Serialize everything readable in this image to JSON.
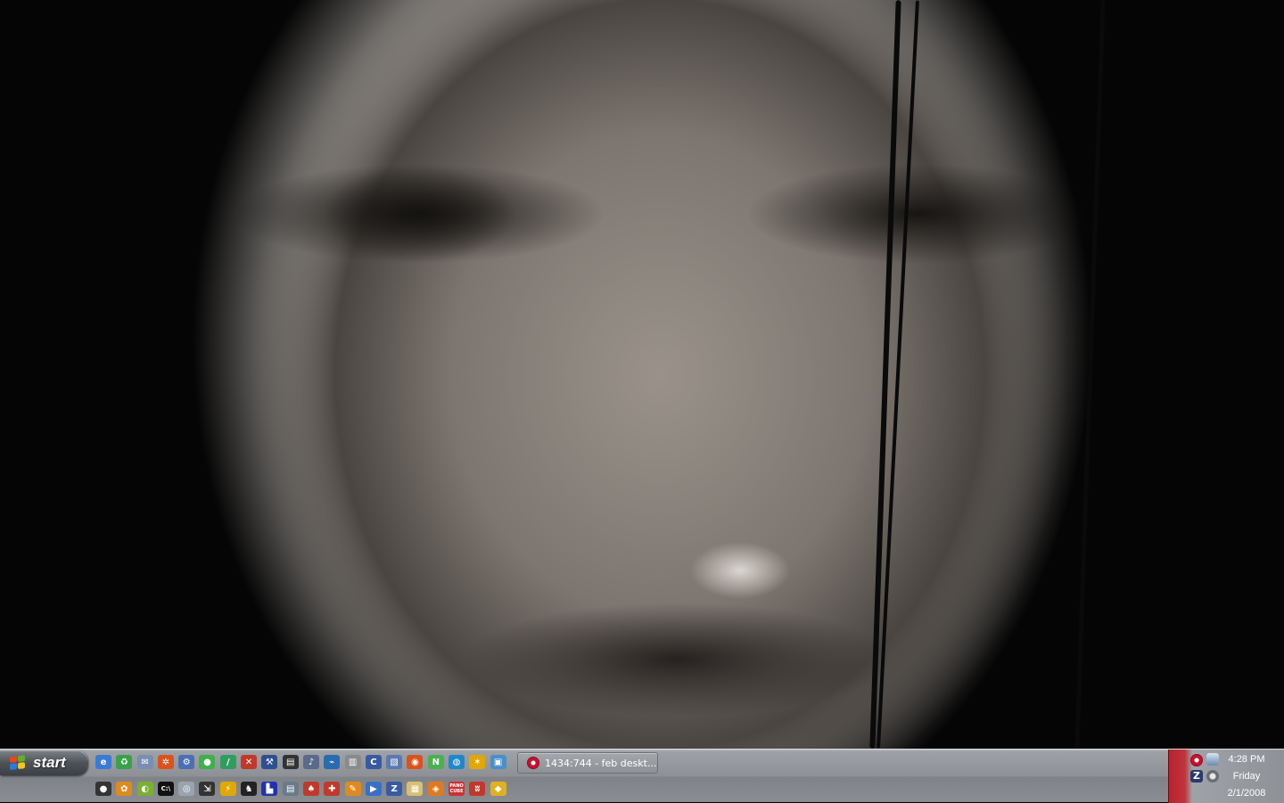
{
  "desktop": {
    "wallpaper": "dark portrait face close-up",
    "colors": {
      "skin": "#9a928a",
      "shadow": "#050505"
    }
  },
  "taskbar": {
    "start_label": "start",
    "quicklaunch_row1": [
      {
        "icon": "ie-icon",
        "glyph": "e",
        "color": "#3a7bd5"
      },
      {
        "icon": "recycle-icon",
        "glyph": "♻",
        "color": "#3aa14a"
      },
      {
        "icon": "mail-icon",
        "glyph": "✉",
        "color": "#7a8fb0"
      },
      {
        "icon": "network-icon",
        "glyph": "✲",
        "color": "#d9531e"
      },
      {
        "icon": "gear-icon",
        "glyph": "⚙",
        "color": "#4a6fb5"
      },
      {
        "icon": "chat-icon",
        "glyph": "●",
        "color": "#3fb04a"
      },
      {
        "icon": "pen-icon",
        "glyph": "/",
        "color": "#2f9e5c"
      },
      {
        "icon": "scissors-icon",
        "glyph": "✕",
        "color": "#c0392b"
      },
      {
        "icon": "tool-icon",
        "glyph": "⚒",
        "color": "#2f4f8f"
      },
      {
        "icon": "film-icon",
        "glyph": "▤",
        "color": "#333333"
      },
      {
        "icon": "music-icon",
        "glyph": "♪",
        "color": "#5a6a8a"
      },
      {
        "icon": "chart-icon",
        "glyph": "⌁",
        "color": "#2a6bb0"
      },
      {
        "icon": "printer-icon",
        "glyph": "▥",
        "color": "#8a8a8a"
      },
      {
        "icon": "c-app-icon",
        "glyph": "C",
        "color": "#3a5aa0"
      },
      {
        "icon": "document-icon",
        "glyph": "▧",
        "color": "#5a7ab0"
      },
      {
        "icon": "firefox-icon",
        "glyph": "◉",
        "color": "#d9531e"
      },
      {
        "icon": "n-app-icon",
        "glyph": "N",
        "color": "#4caf50"
      },
      {
        "icon": "globe-icon",
        "glyph": "◍",
        "color": "#1e88c8"
      },
      {
        "icon": "star-icon",
        "glyph": "✶",
        "color": "#e0a800"
      },
      {
        "icon": "monitor-icon",
        "glyph": "▣",
        "color": "#4a90c8"
      }
    ],
    "quicklaunch_row2": [
      {
        "icon": "bug-icon",
        "glyph": "●",
        "color": "#333333"
      },
      {
        "icon": "paint-icon",
        "glyph": "✿",
        "color": "#e08a1e"
      },
      {
        "icon": "orb-icon",
        "glyph": "◐",
        "color": "#7ab02f"
      },
      {
        "icon": "cmd-icon",
        "glyph": "C:\\",
        "color": "#111111"
      },
      {
        "icon": "disc-icon",
        "glyph": "◎",
        "color": "#9aa4b0"
      },
      {
        "icon": "arrow-icon",
        "glyph": "⇲",
        "color": "#333333"
      },
      {
        "icon": "winamp-icon",
        "glyph": "⚡",
        "color": "#e0a800"
      },
      {
        "icon": "bird-icon",
        "glyph": "♞",
        "color": "#222222"
      },
      {
        "icon": "game-icon",
        "glyph": "▙",
        "color": "#2233aa"
      },
      {
        "icon": "files-icon",
        "glyph": "▤",
        "color": "#6a7a8a"
      },
      {
        "icon": "poker-icon",
        "glyph": "♠",
        "color": "#c0392b"
      },
      {
        "icon": "gift-icon",
        "glyph": "✚",
        "color": "#c0392b"
      },
      {
        "icon": "pencil-icon",
        "glyph": "✎",
        "color": "#e08a1e"
      },
      {
        "icon": "player-icon",
        "glyph": "▶",
        "color": "#3a6fc8"
      },
      {
        "icon": "z-app-icon",
        "glyph": "Z",
        "color": "#3a5aa0"
      },
      {
        "icon": "notepad-icon",
        "glyph": "▦",
        "color": "#d8c070"
      },
      {
        "icon": "box-icon",
        "glyph": "◈",
        "color": "#e07a1e"
      },
      {
        "icon": "panocube-icon",
        "glyph": "PANO CUBE",
        "color": "#d03030"
      },
      {
        "icon": "bat-icon",
        "glyph": "ʬ",
        "color": "#c0392b"
      },
      {
        "icon": "pizza-icon",
        "glyph": "◆",
        "color": "#e0b020"
      }
    ],
    "task_window_label": "1434:744 - feb deskt...",
    "clock": {
      "time": "4:28 PM",
      "day": "Friday",
      "date": "2/1/2008"
    },
    "tray_icons": [
      "bittorrent-icon",
      "network-icon",
      "zonealarm-icon",
      "antivirus-icon"
    ]
  }
}
